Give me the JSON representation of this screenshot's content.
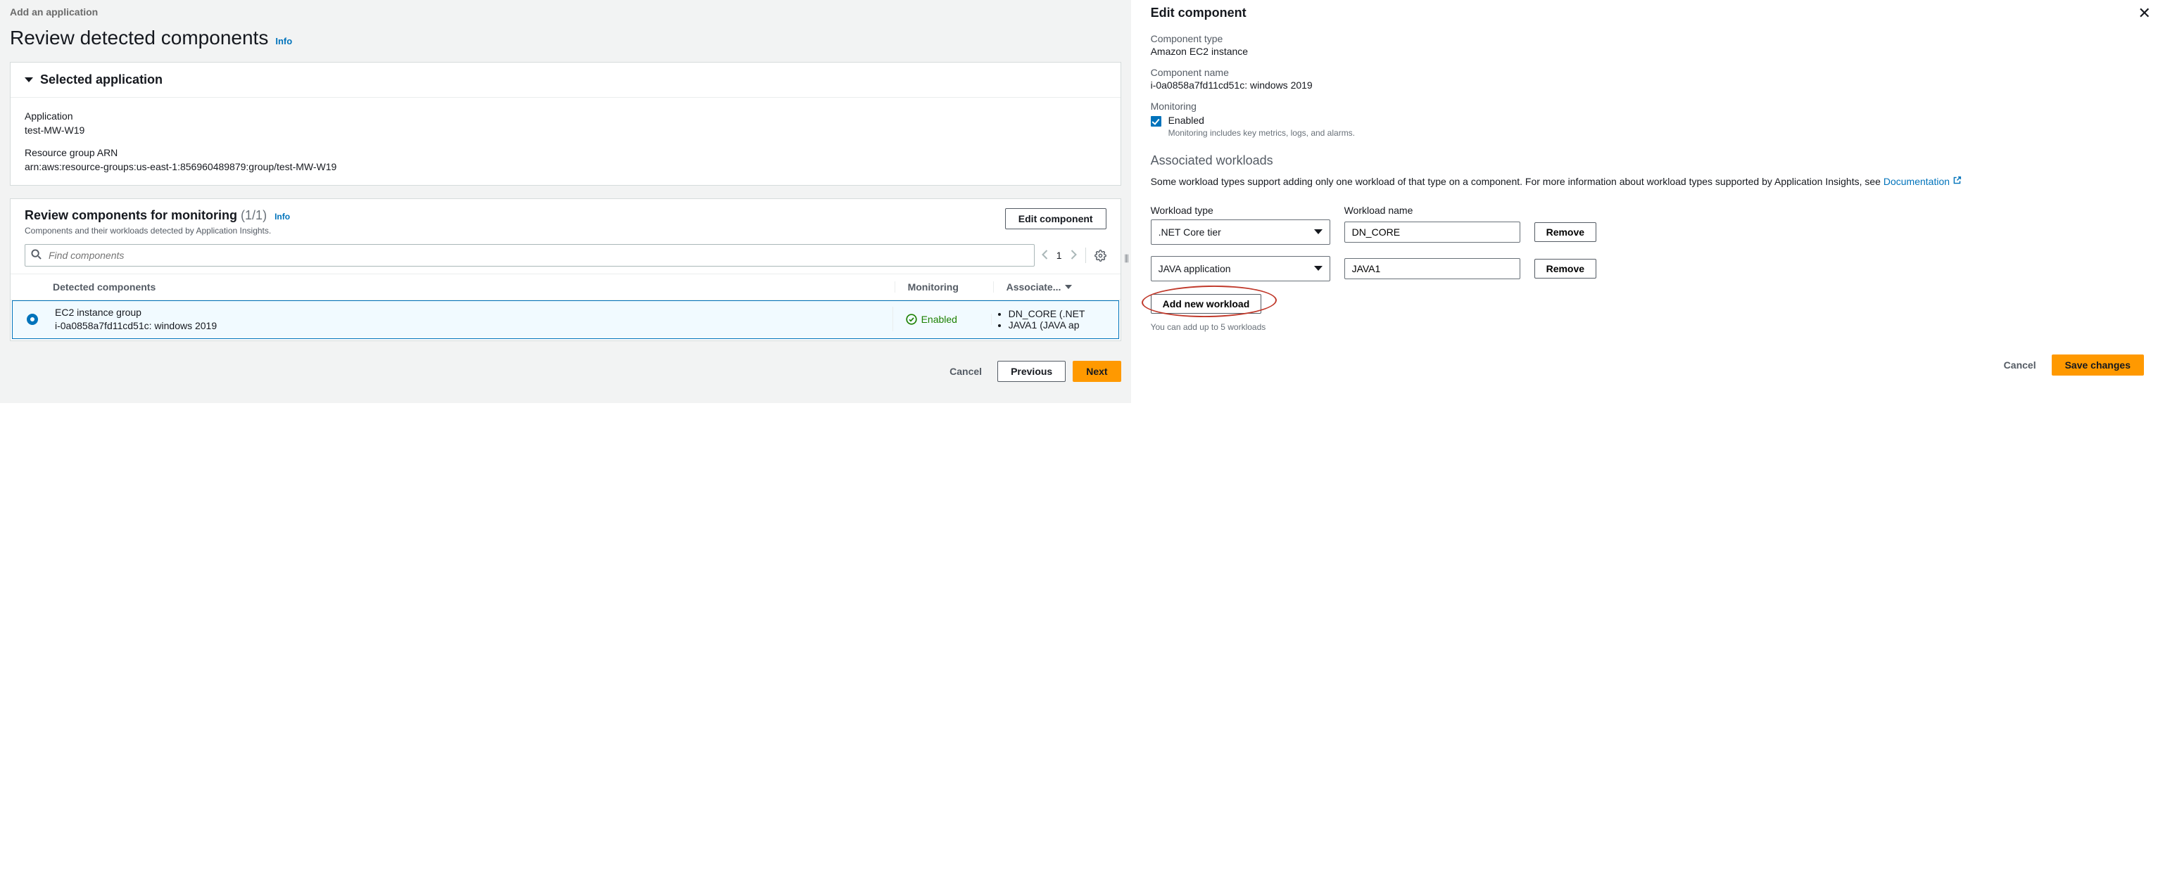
{
  "breadcrumb": "Add an application",
  "page_title": "Review detected components",
  "info_label": "Info",
  "selected_app": {
    "header": "Selected application",
    "application_label": "Application",
    "application_value": "test-MW-W19",
    "rg_arn_label": "Resource group ARN",
    "rg_arn_value": "arn:aws:resource-groups:us-east-1:856960489879:group/test-MW-W19"
  },
  "review": {
    "title": "Review components for monitoring",
    "count": "(1/1)",
    "info": "Info",
    "sub": "Components and their workloads detected by Application Insights.",
    "edit_btn": "Edit component",
    "search_placeholder": "Find components",
    "page_number": "1",
    "columns": {
      "radio": "",
      "comp": "Detected components",
      "mon": "Monitoring",
      "assoc": "Associate..."
    },
    "row": {
      "title": "EC2 instance group",
      "sub": "i-0a0858a7fd11cd51c: windows 2019",
      "status": "Enabled",
      "assoc": [
        "DN_CORE (.NET",
        "JAVA1 (JAVA ap"
      ]
    }
  },
  "footer": {
    "cancel": "Cancel",
    "previous": "Previous",
    "next": "Next"
  },
  "right": {
    "title": "Edit component",
    "comp_type_label": "Component type",
    "comp_type_value": "Amazon EC2 instance",
    "comp_name_label": "Component name",
    "comp_name_value": "i-0a0858a7fd11cd51c: windows 2019",
    "monitoring_label": "Monitoring",
    "enabled_label": "Enabled",
    "enabled_helper": "Monitoring includes key metrics, logs, and alarms.",
    "assoc_title": "Associated workloads",
    "assoc_desc_pre": "Some workload types support adding only one workload of that type on a component. For more information about workload types supported by Application Insights, see ",
    "assoc_desc_link": "Documentation",
    "wk_type_label": "Workload type",
    "wk_name_label": "Workload name",
    "workloads": [
      {
        "type": ".NET Core tier",
        "name": "DN_CORE"
      },
      {
        "type": "JAVA application",
        "name": "JAVA1"
      }
    ],
    "remove_label": "Remove",
    "add_label": "Add new workload",
    "limit_note": "You can add up to 5 workloads",
    "cancel": "Cancel",
    "save": "Save changes"
  }
}
